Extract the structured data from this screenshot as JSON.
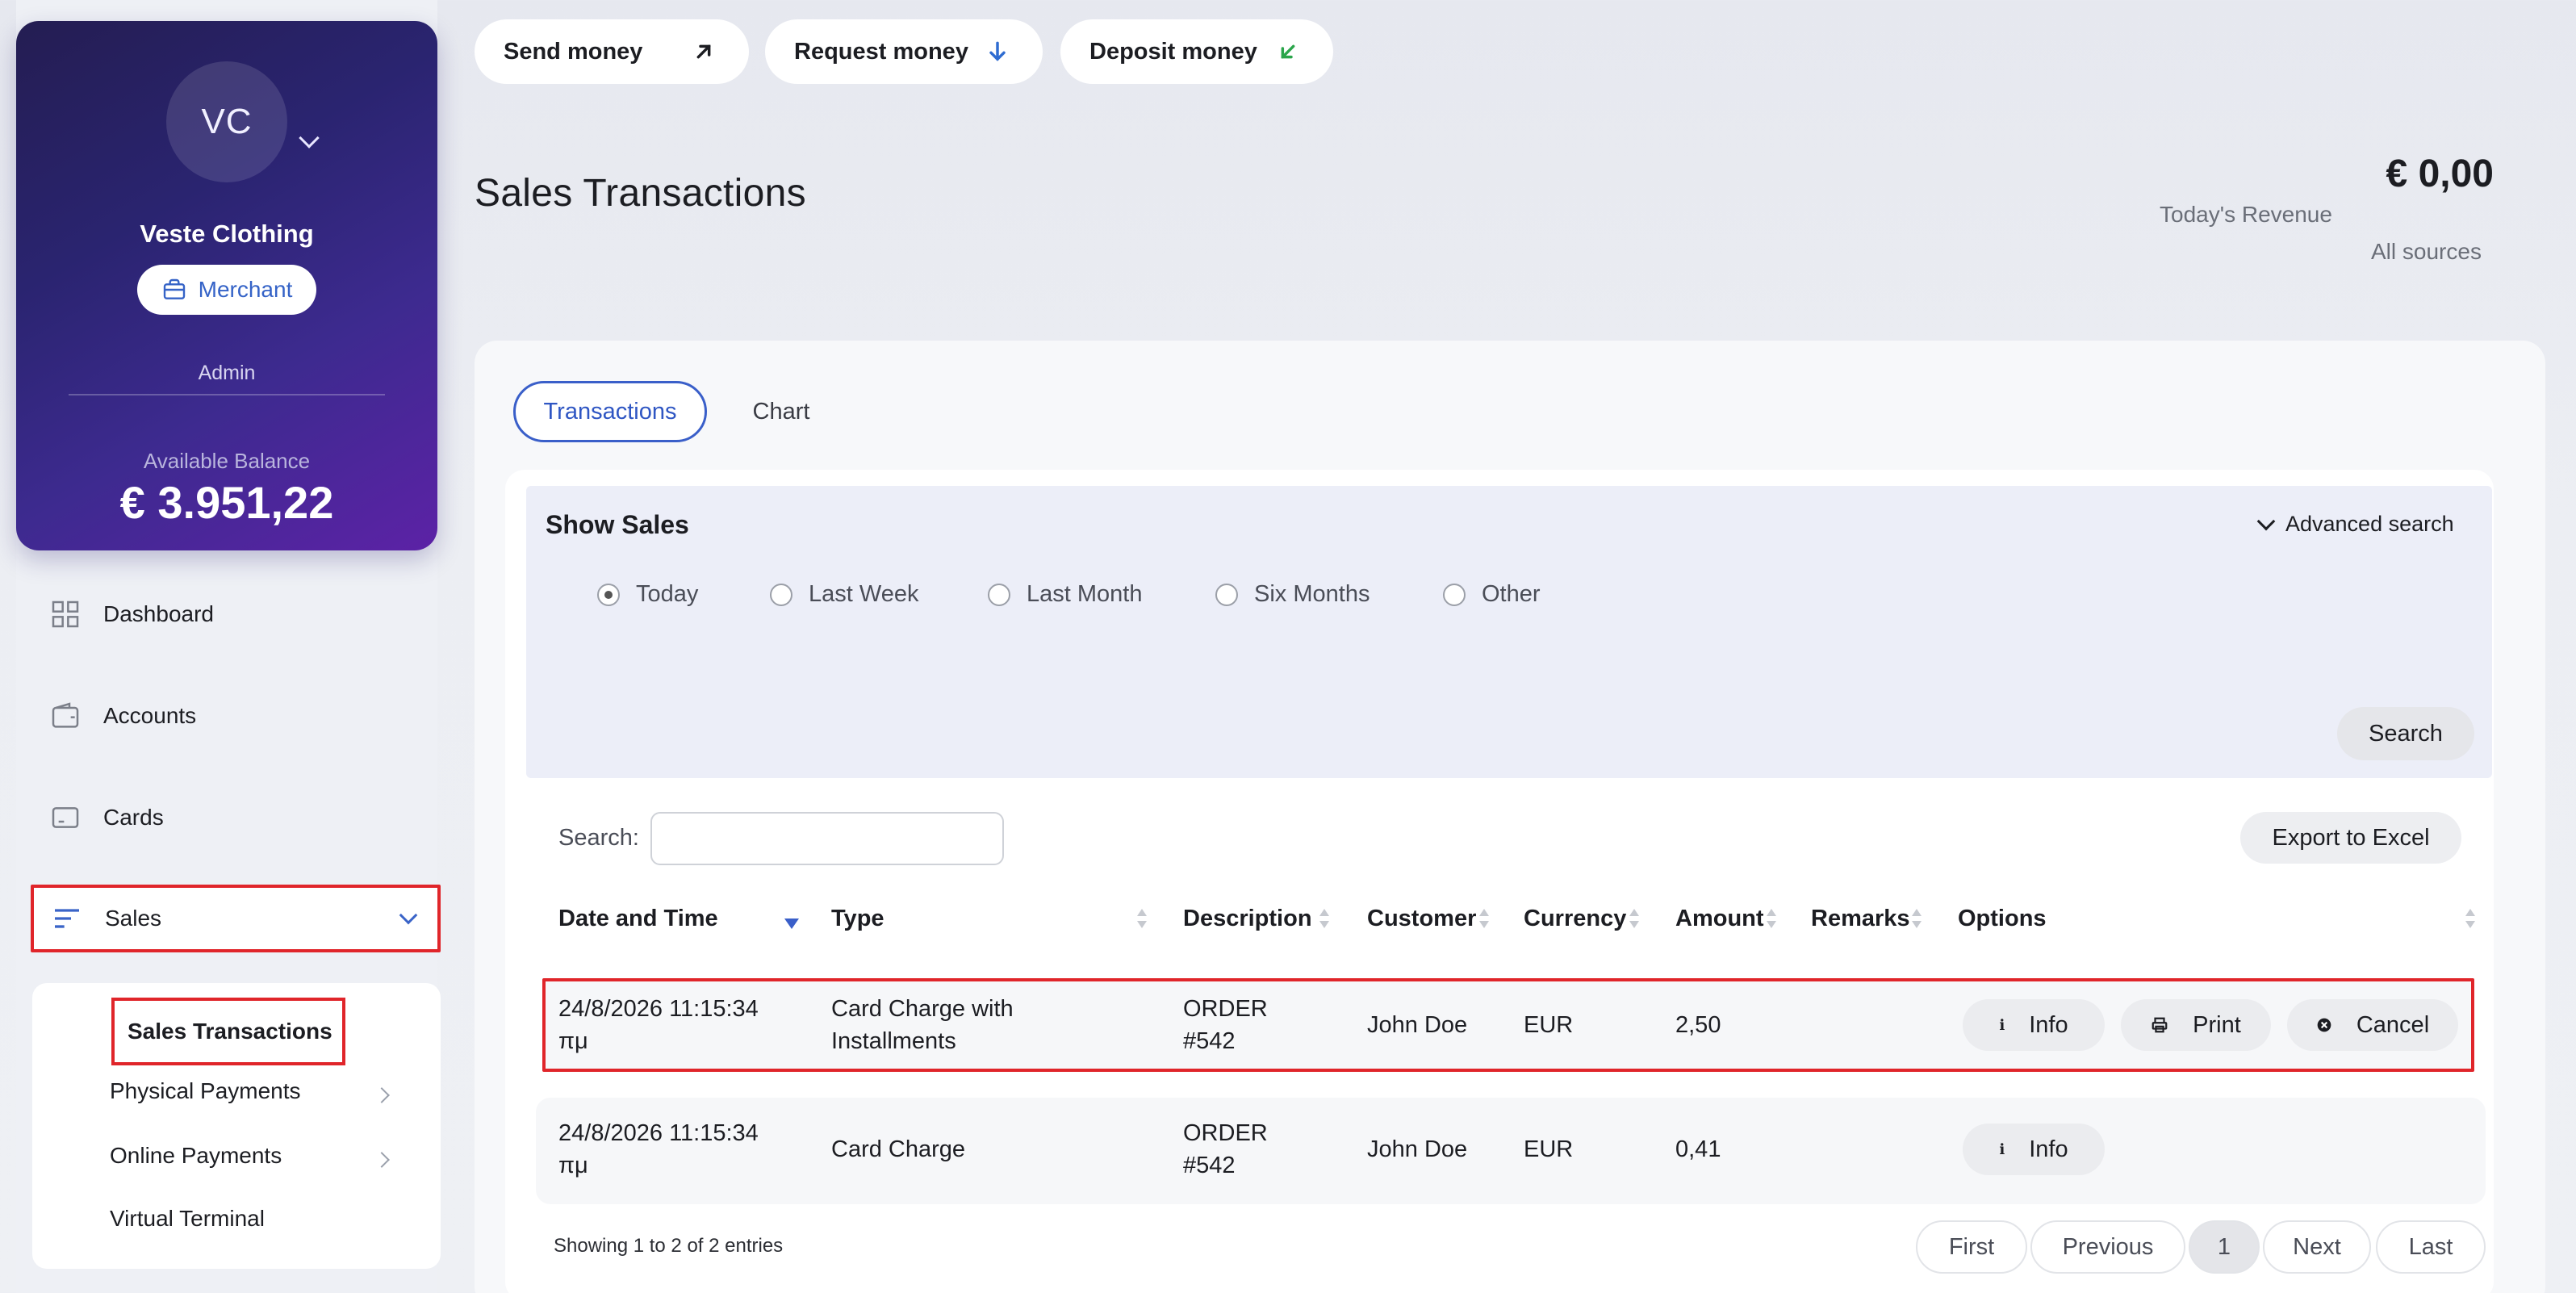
{
  "actions": {
    "send": "Send money",
    "request": "Request money",
    "deposit": "Deposit money"
  },
  "colors": {
    "accent": "#2f56c3",
    "highlight": "#e0252a",
    "send_icon": "#1c1d22",
    "request_icon": "#2f6cd1",
    "deposit_icon": "#2aa54a"
  },
  "profile": {
    "initials": "VC",
    "company": "Veste Clothing",
    "badge": "Merchant",
    "role": "Admin",
    "balance_label": "Available Balance",
    "balance": "€ 3.951,22"
  },
  "nav": {
    "dashboard": "Dashboard",
    "accounts": "Accounts",
    "cards": "Cards",
    "sales": "Sales",
    "sub": {
      "sales_transactions": "Sales Transactions",
      "physical_payments": "Physical Payments",
      "online_payments": "Online Payments",
      "virtual_terminal": "Virtual Terminal"
    }
  },
  "header": {
    "title": "Sales Transactions",
    "revenue_amount": "€ 0,00",
    "revenue_label": "Today's Revenue",
    "revenue_sources": "All sources"
  },
  "tabs": {
    "transactions": "Transactions",
    "chart": "Chart"
  },
  "filter": {
    "title": "Show Sales",
    "advanced": "Advanced search",
    "options": [
      "Today",
      "Last Week",
      "Last Month",
      "Six Months",
      "Other"
    ],
    "selected": "Today",
    "search_button": "Search"
  },
  "table": {
    "search_label": "Search:",
    "search_value": "",
    "export_label": "Export to Excel",
    "columns": [
      "Date and Time",
      "Type",
      "Description",
      "Customer",
      "Currency",
      "Amount",
      "Remarks",
      "Options"
    ],
    "rows": [
      {
        "date": "24/8/2026 11:15:34",
        "ampm": "πμ",
        "type_line1": "Card Charge with",
        "type_line2": "Installments",
        "desc_line1": "ORDER",
        "desc_line2": "#542",
        "customer": "John Doe",
        "currency": "EUR",
        "amount": "2,50",
        "remarks": ""
      },
      {
        "date": "24/8/2026 11:15:34",
        "ampm": "πμ",
        "type_line1": "Card Charge",
        "type_line2": "",
        "desc_line1": "ORDER",
        "desc_line2": "#542",
        "customer": "John Doe",
        "currency": "EUR",
        "amount": "0,41",
        "remarks": ""
      }
    ],
    "info_label": "Info",
    "print_label": "Print",
    "cancel_label": "Cancel",
    "showing": "Showing 1 to 2 of 2 entries"
  },
  "pagination": {
    "first": "First",
    "previous": "Previous",
    "current": "1",
    "next": "Next",
    "last": "Last"
  }
}
